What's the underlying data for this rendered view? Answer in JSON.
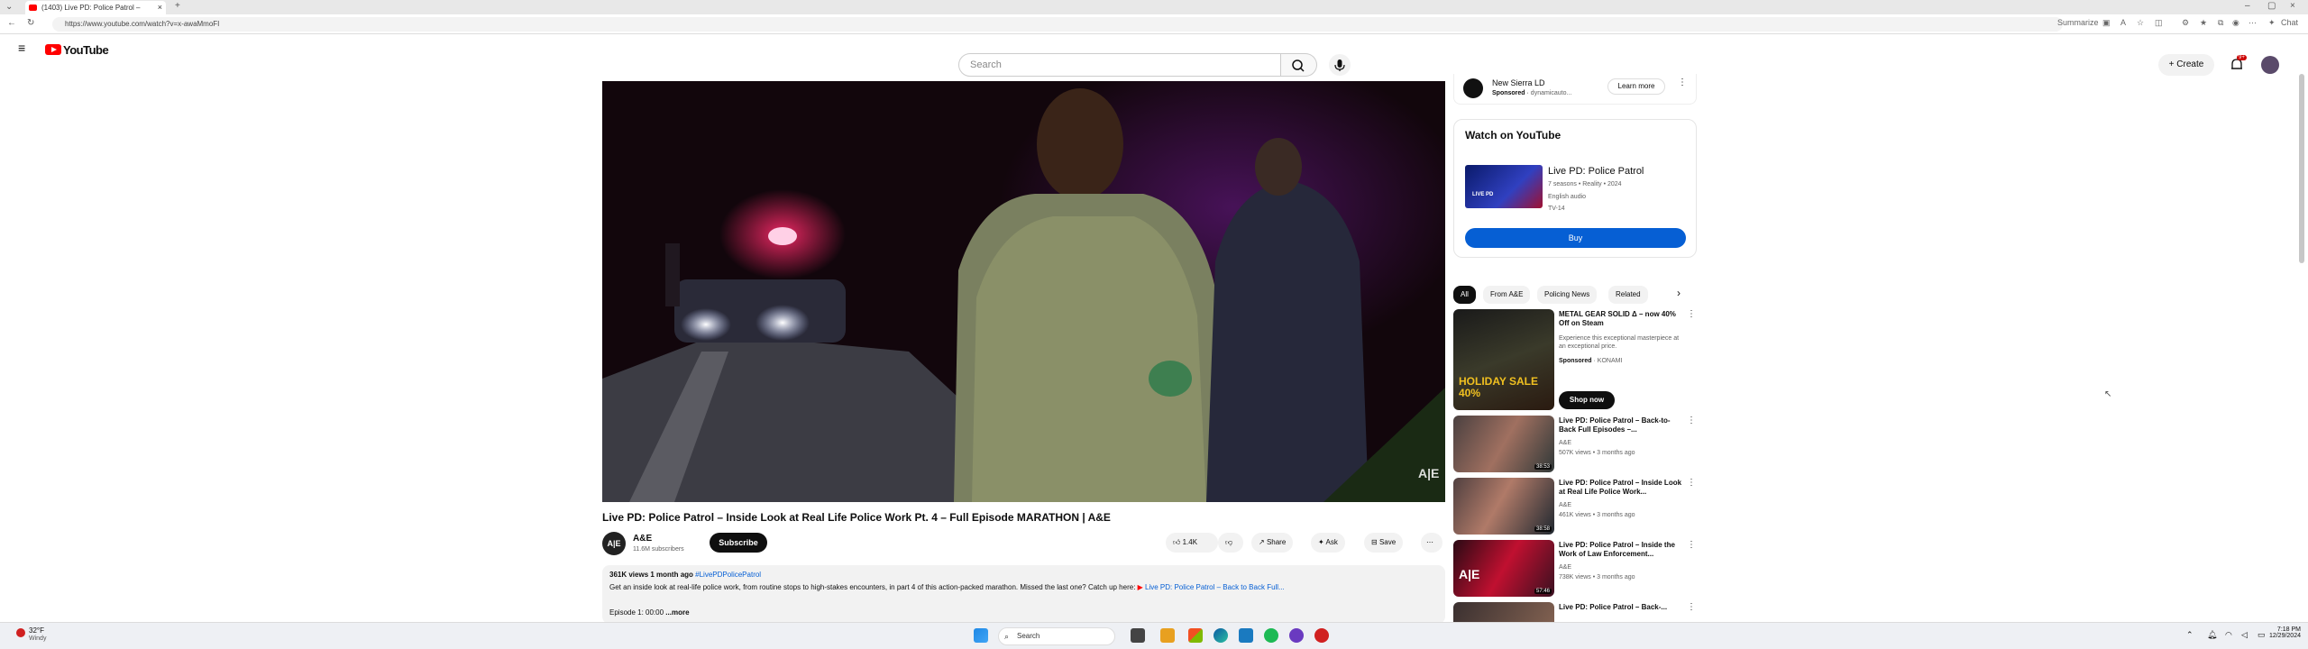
{
  "browser": {
    "tab_title": "(1403) Live PD: Police Patrol –",
    "url": "https://www.youtube.com/watch?v=x-awaMmoFI",
    "summarize_label": "Summarize",
    "new_tab": "+",
    "chat_label": "Chat"
  },
  "youtube": {
    "logo_text": "YouTube",
    "search_placeholder": "Search",
    "create_label": "Create",
    "notif_count": "9+"
  },
  "video": {
    "title": "Live PD: Police Patrol – Inside Look at Real Life Police Work Pt. 4 – Full Episode MARATHON | A&E",
    "channel": "A&E",
    "subscribers": "11.6M subscribers",
    "subscribe_label": "Subscribe",
    "likes": "1.4K",
    "share_label": "Share",
    "ask_label": "Ask",
    "save_label": "Save",
    "views_age": "361K views  1 month ago",
    "hashtag": "#LivePDPolicePatrol",
    "description": "Get an inside look at real-life police work, from routine stops to high-stakes encounters, in part 4 of this action-packed marathon. Missed the last one? Catch up here: ",
    "description_link": "Live PD: Police Patrol – Back to Back Full...",
    "episode_line": "Episode 1: 00:00",
    "more_label": "...more",
    "watermark": "A|E"
  },
  "sidebar": {
    "top_ad": {
      "name": "New Sierra LD",
      "sponsored": "Sponsored",
      "source": "dynamicauto...",
      "cta": "Learn more"
    },
    "watch_on": {
      "heading": "Watch on YouTube",
      "show_title": "Live PD: Police Patrol",
      "meta": "7 seasons • Reality • 2024",
      "audio": "English audio",
      "rating": "TV-14",
      "buy_label": "Buy"
    },
    "chips": [
      "All",
      "From A&E",
      "Policing News",
      "Related"
    ],
    "ad_card": {
      "title": "METAL GEAR SOLID Δ – now 40% Off on Steam",
      "text": "Experience this exceptional masterpiece at an exceptional price.",
      "sponsored": "Sponsored",
      "source": "KONAMI",
      "cta": "Shop now",
      "thumb_text": "HOLIDAY SALE 40%"
    },
    "recommendations": [
      {
        "title": "Live PD: Police Patrol – Back-to-Back Full Episodes –...",
        "channel": "A&E",
        "meta": "507K views • 3 months ago",
        "duration": "38:53"
      },
      {
        "title": "Live PD: Police Patrol – Inside Look at Real Life Police Work...",
        "channel": "A&E",
        "meta": "461K views • 3 months ago",
        "duration": "38:58"
      },
      {
        "title": "Live PD: Police Patrol – Inside the Work of Law Enforcement...",
        "channel": "A&E",
        "meta": "738K views • 3 months ago",
        "duration": "57:46"
      },
      {
        "title": "Live PD: Police Patrol – Back-...",
        "channel": "",
        "meta": "",
        "duration": ""
      }
    ]
  },
  "taskbar": {
    "weather_temp": "32°F",
    "weather_cond": "Windy",
    "search_label": "Search",
    "time": "7:18 PM",
    "date": "12/29/2024"
  },
  "colors": {
    "youtube_red": "#ff0000",
    "link_blue": "#065fd4",
    "buy_blue": "#065fd4"
  }
}
